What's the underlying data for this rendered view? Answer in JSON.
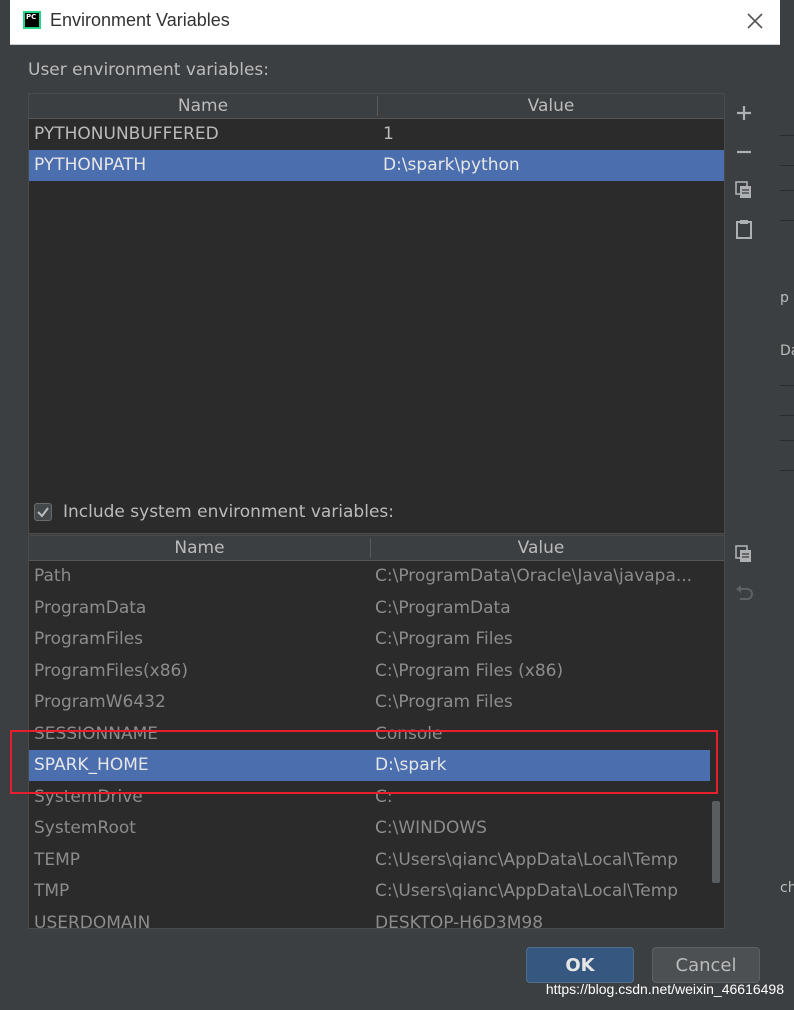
{
  "window": {
    "title": "Environment Variables",
    "app_icon_label": "PC"
  },
  "user_section": {
    "label": "User environment variables:",
    "columns": {
      "name": "Name",
      "value": "Value"
    },
    "rows": [
      {
        "name": "PYTHONUNBUFFERED",
        "value": "1",
        "selected": false
      },
      {
        "name": "PYTHONPATH",
        "value": "D:\\spark\\python",
        "selected": true
      }
    ],
    "tools": [
      "add-icon",
      "remove-icon",
      "copy-icon",
      "paste-icon"
    ]
  },
  "system_section": {
    "checkbox_label": "Include system environment variables:",
    "checked": true,
    "columns": {
      "name": "Name",
      "value": "Value"
    },
    "rows": [
      {
        "name": "Path",
        "value": "C:\\ProgramData\\Oracle\\Java\\javapa...",
        "selected": false
      },
      {
        "name": "ProgramData",
        "value": "C:\\ProgramData",
        "selected": false
      },
      {
        "name": "ProgramFiles",
        "value": "C:\\Program Files",
        "selected": false
      },
      {
        "name": "ProgramFiles(x86)",
        "value": "C:\\Program Files (x86)",
        "selected": false
      },
      {
        "name": "ProgramW6432",
        "value": "C:\\Program Files",
        "selected": false
      },
      {
        "name": "SESSIONNAME",
        "value": "Console",
        "selected": false
      },
      {
        "name": "SPARK_HOME",
        "value": "D:\\spark",
        "selected": true
      },
      {
        "name": "SystemDrive",
        "value": "C:",
        "selected": false
      },
      {
        "name": "SystemRoot",
        "value": "C:\\WINDOWS",
        "selected": false
      },
      {
        "name": "TEMP",
        "value": "C:\\Users\\qianc\\AppData\\Local\\Temp",
        "selected": false
      },
      {
        "name": "TMP",
        "value": "C:\\Users\\qianc\\AppData\\Local\\Temp",
        "selected": false
      },
      {
        "name": "USERDOMAIN",
        "value": "DESKTOP-H6D3M98",
        "selected": false
      }
    ],
    "tools": [
      "copy-icon",
      "undo-icon"
    ]
  },
  "buttons": {
    "ok": "OK",
    "cancel": "Cancel"
  },
  "watermark": "https://blog.csdn.net/weixin_46616498",
  "background_fragments": [
    "p",
    "Da",
    "ch"
  ],
  "colors": {
    "selection": "#4b6eaf",
    "highlight_box": "#e5202c",
    "ok_button": "#365880"
  }
}
